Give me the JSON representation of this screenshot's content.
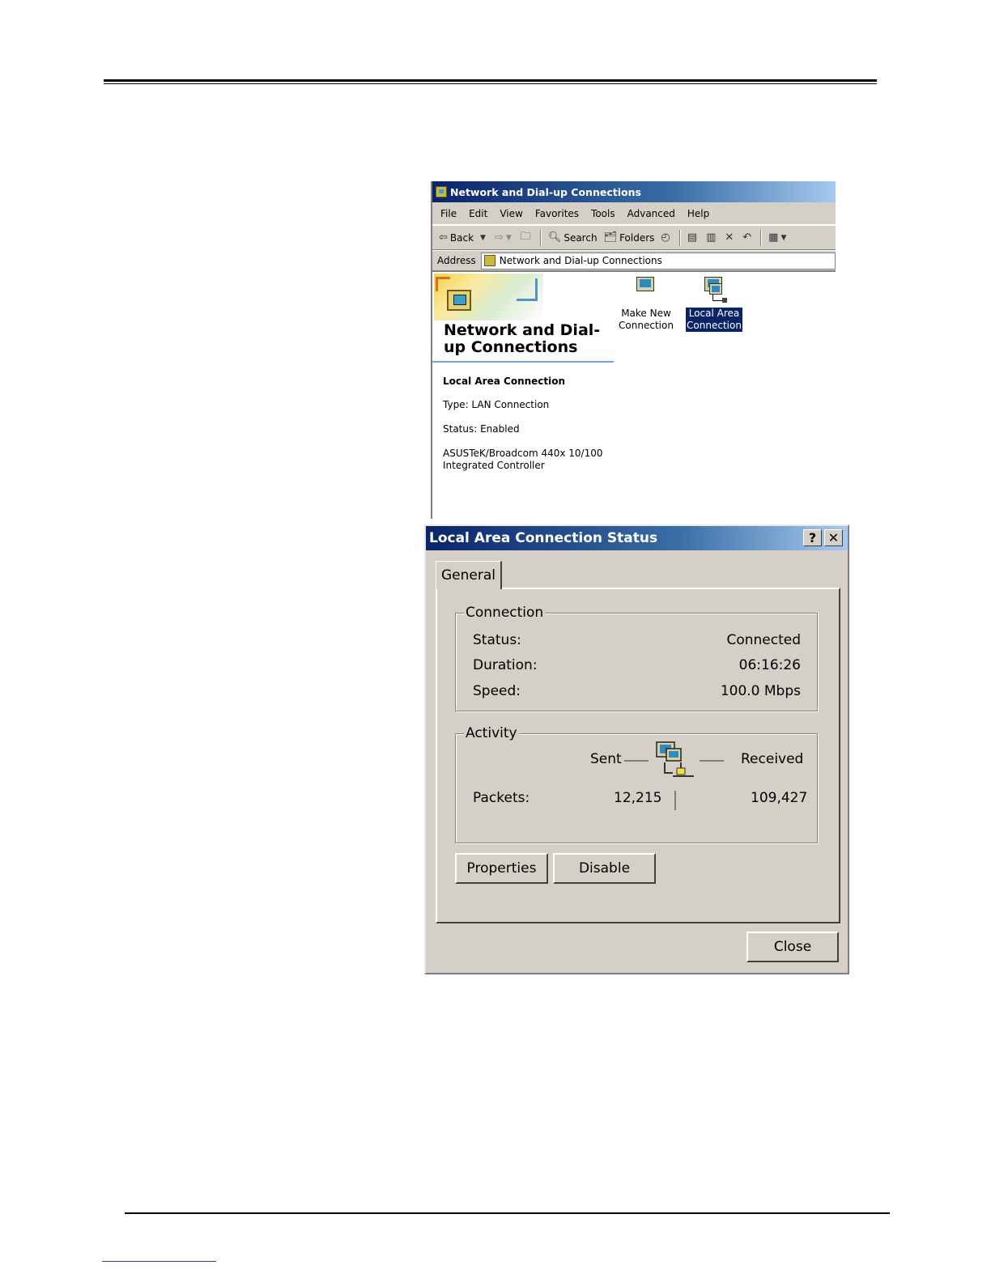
{
  "explorer": {
    "title": "Network and Dial-up Connections",
    "menu": [
      "File",
      "Edit",
      "View",
      "Favorites",
      "Tools",
      "Advanced",
      "Help"
    ],
    "toolbar": {
      "back": "Back",
      "search": "Search",
      "folders": "Folders"
    },
    "address": {
      "label": "Address",
      "value": "Network and Dial-up Connections"
    },
    "banner_title": "Network and Dial-up Connections",
    "details": {
      "name": "Local Area Connection",
      "type": "Type: LAN Connection",
      "status": "Status: Enabled",
      "device": "ASUSTeK/Broadcom 440x 10/100 Integrated Controller"
    },
    "icons": [
      {
        "label": "Make New Connection",
        "icon": "make-new-connection-icon"
      },
      {
        "label": "Local Area Connection",
        "icon": "network-connection-icon",
        "selected": true
      }
    ]
  },
  "dialog": {
    "title": "Local Area Connection Status",
    "help_glyph": "?",
    "close_glyph": "✕",
    "tab": "General",
    "connection": {
      "legend": "Connection",
      "status_label": "Status:",
      "status_value": "Connected",
      "duration_label": "Duration:",
      "duration_value": "06:16:26",
      "speed_label": "Speed:",
      "speed_value": "100.0 Mbps"
    },
    "activity": {
      "legend": "Activity",
      "sent_label": "Sent",
      "received_label": "Received",
      "packets_label": "Packets:",
      "sent_value": "12,215",
      "received_value": "109,427"
    },
    "buttons": {
      "properties": "Properties",
      "disable": "Disable",
      "close": "Close"
    }
  }
}
